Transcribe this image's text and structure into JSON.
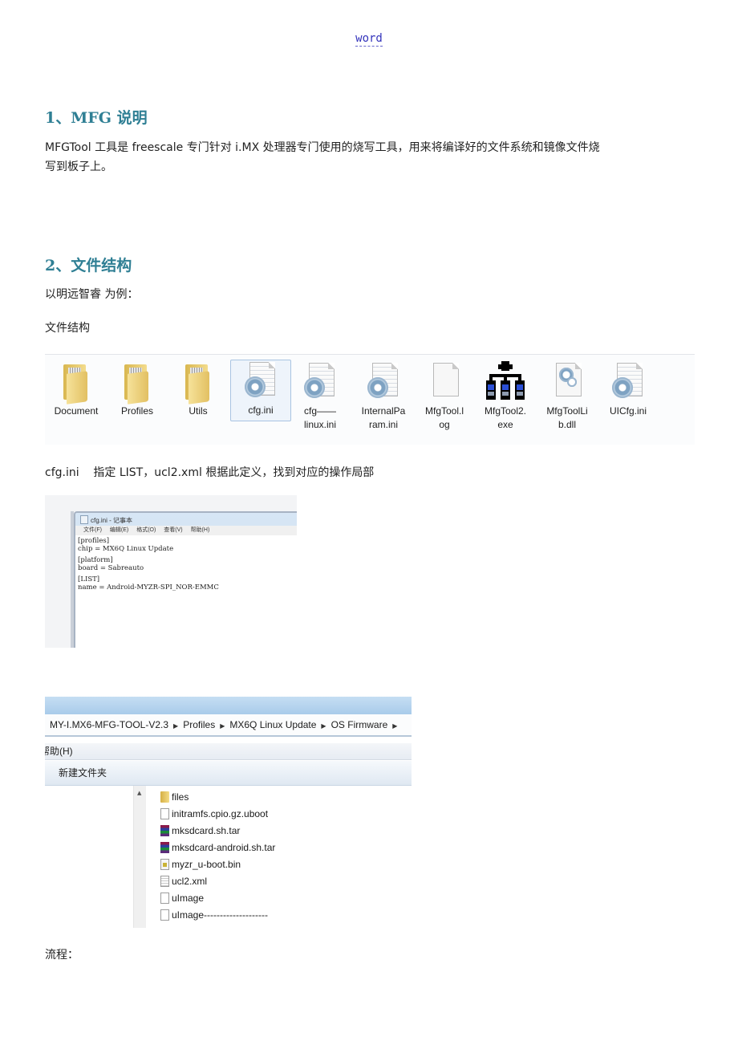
{
  "header": {
    "link_text": "word"
  },
  "section1": {
    "heading": "1、MFG 说明",
    "paragraph_line1": "MFGTool 工具是 freescale 专门针对 i.MX 处理器专门使用的烧写工具，用来将编译好的文件系统和镜像文件烧",
    "paragraph_line2": "写到板子上。"
  },
  "section2": {
    "heading": "2、文件结构",
    "example_text": "以明远智睿  为例：",
    "file_structure_label": "文件结构"
  },
  "file_strip": {
    "items": [
      {
        "name": "Document",
        "icon": "folder-icon"
      },
      {
        "name": "Profiles",
        "icon": "folder-icon"
      },
      {
        "name": "Utils",
        "icon": "folder-icon"
      },
      {
        "name": "cfg.ini",
        "icon": "config-file-icon",
        "selected": true
      },
      {
        "name": "cfg——linux.ini",
        "line1": "cfg——",
        "line2": "linux.ini",
        "icon": "config-file-icon"
      },
      {
        "name": "InternalParam.ini",
        "line1": "InternalPa",
        "line2": "ram.ini",
        "icon": "config-file-icon"
      },
      {
        "name": "MfgTool.log",
        "line1": "MfgTool.l",
        "line2": "og",
        "icon": "blank-file-icon"
      },
      {
        "name": "MfgTool2.exe",
        "line1": "MfgTool2.",
        "line2": "exe",
        "icon": "network-exe-icon"
      },
      {
        "name": "MfgToolLib.dll",
        "line1": "MfgToolLi",
        "line2": "b.dll",
        "icon": "dll-file-icon"
      },
      {
        "name": "UICfg.ini",
        "icon": "config-file-icon"
      }
    ]
  },
  "cfg_note": "cfg.ini    指定 LIST，ucl2.xml 根据此定义，找到对应的操作局部",
  "notepad": {
    "title": "cfg.ini - 记事本",
    "menu": [
      "文件(F)",
      "编辑(E)",
      "格式(O)",
      "查看(V)",
      "帮助(H)"
    ],
    "content_lines": [
      "[profiles]",
      "chip = MX6Q Linux Update",
      "",
      "[platform]",
      "board = Sabreauto",
      "",
      "[LIST]",
      "name = Android-MYZR-SPI_NOR-EMMC"
    ]
  },
  "explorer": {
    "breadcrumb": [
      "MY-I.MX6-MFG-TOOL-V2.3",
      "Profiles",
      "MX6Q Linux Update",
      "OS Firmware"
    ],
    "menu_partial": "帮助(H)",
    "toolbar_new_folder": "新建文件夹",
    "files": [
      {
        "name": "files",
        "icon": "folder-icon"
      },
      {
        "name": "initramfs.cpio.gz.uboot",
        "icon": "file-icon"
      },
      {
        "name": "mksdcard.sh.tar",
        "icon": "rar-archive-icon"
      },
      {
        "name": "mksdcard-android.sh.tar",
        "icon": "rar-archive-icon"
      },
      {
        "name": "myzr_u-boot.bin",
        "icon": "bin-file-icon"
      },
      {
        "name": "ucl2.xml",
        "icon": "text-file-icon"
      },
      {
        "name": "uImage",
        "icon": "file-icon"
      },
      {
        "name": "uImage--------------------",
        "icon": "file-icon"
      }
    ]
  },
  "flow_label": "流程："
}
